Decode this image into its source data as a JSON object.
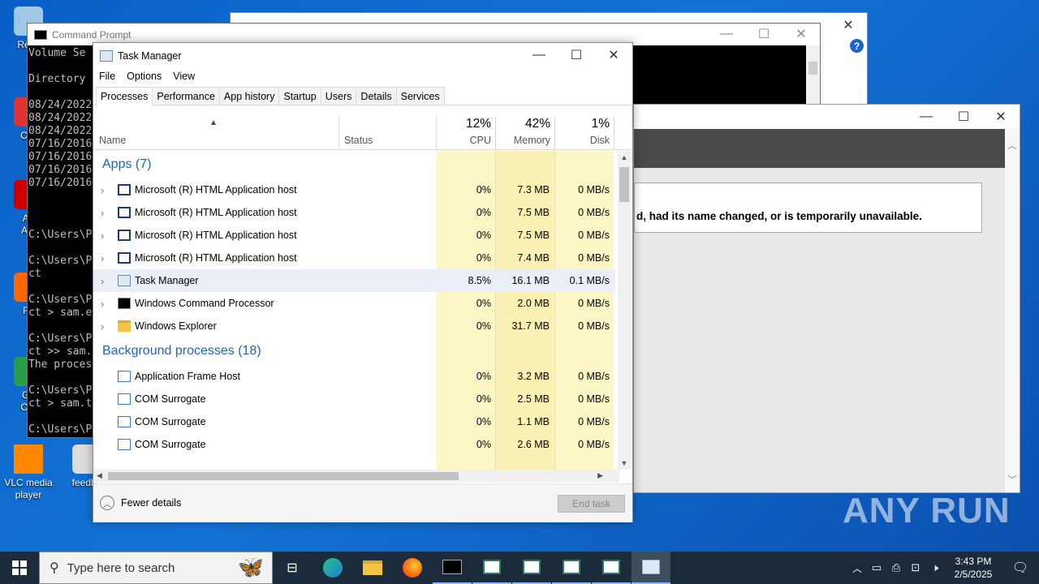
{
  "desktop": {
    "icons": [
      {
        "label": "Recy",
        "icon": "recycle-bin-icon"
      },
      {
        "label": "CCl",
        "icon": "ccleaner-icon"
      },
      {
        "label": "Ad\nAcr",
        "icon": "acrobat-icon"
      },
      {
        "label": "Fir",
        "icon": "firefox-icon"
      },
      {
        "label": "Go\nChr",
        "icon": "chrome-icon"
      },
      {
        "label": "VLC media\nplayer",
        "icon": "vlc-icon"
      },
      {
        "label": "feedba",
        "icon": "file-icon"
      }
    ]
  },
  "cmd": {
    "title": "Command Prompt",
    "lines": "Volume Se\n\nDirectory\n\n08/24/2022\n08/24/2022\n08/24/2022\n07/16/2016\n07/16/2016\n07/16/2016\n07/16/2016\n\n\n\nC:\\Users\\P\n\nC:\\Users\\P\nct\n\nC:\\Users\\P\nct > sam.e\n\nC:\\Users\\P\nct >> sam.\nThe proces\n\nC:\\Users\\P\nct > sam.t\n\nC:\\Users\\P"
  },
  "browser": {
    "error_text": "d, had its name changed, or is temporarily unavailable."
  },
  "taskmanager": {
    "title": "Task Manager",
    "menu": [
      "File",
      "Options",
      "View"
    ],
    "tabs": [
      "Processes",
      "Performance",
      "App history",
      "Startup",
      "Users",
      "Details",
      "Services"
    ],
    "active_tab": "Processes",
    "columns": {
      "name": "Name",
      "status": "Status",
      "cpu_pct": "12%",
      "cpu": "CPU",
      "mem_pct": "42%",
      "mem": "Memory",
      "disk_pct": "1%",
      "disk": "Disk"
    },
    "groups": [
      {
        "label": "Apps (7)",
        "rows": [
          {
            "name": "Microsoft (R) HTML Application host",
            "cpu": "0%",
            "mem": "7.3 MB",
            "disk": "0 MB/s",
            "icon": "window-icon",
            "expandable": true
          },
          {
            "name": "Microsoft (R) HTML Application host",
            "cpu": "0%",
            "mem": "7.5 MB",
            "disk": "0 MB/s",
            "icon": "window-icon",
            "expandable": true
          },
          {
            "name": "Microsoft (R) HTML Application host",
            "cpu": "0%",
            "mem": "7.5 MB",
            "disk": "0 MB/s",
            "icon": "window-icon",
            "expandable": true
          },
          {
            "name": "Microsoft (R) HTML Application host",
            "cpu": "0%",
            "mem": "7.4 MB",
            "disk": "0 MB/s",
            "icon": "window-icon",
            "expandable": true
          },
          {
            "name": "Task Manager",
            "cpu": "8.5%",
            "mem": "16.1 MB",
            "disk": "0.1 MB/s",
            "icon": "task-manager-icon",
            "expandable": true,
            "selected": true
          },
          {
            "name": "Windows Command Processor",
            "cpu": "0%",
            "mem": "2.0 MB",
            "disk": "0 MB/s",
            "icon": "cmd-icon",
            "expandable": true
          },
          {
            "name": "Windows Explorer",
            "cpu": "0%",
            "mem": "31.7 MB",
            "disk": "0 MB/s",
            "icon": "folder-icon",
            "expandable": true
          }
        ]
      },
      {
        "label": "Background processes (18)",
        "rows": [
          {
            "name": "Application Frame Host",
            "cpu": "0%",
            "mem": "3.2 MB",
            "disk": "0 MB/s",
            "icon": "app-icon",
            "expandable": false
          },
          {
            "name": "COM Surrogate",
            "cpu": "0%",
            "mem": "2.5 MB",
            "disk": "0 MB/s",
            "icon": "app-icon",
            "expandable": false
          },
          {
            "name": "COM Surrogate",
            "cpu": "0%",
            "mem": "1.1 MB",
            "disk": "0 MB/s",
            "icon": "app-icon",
            "expandable": false
          },
          {
            "name": "COM Surrogate",
            "cpu": "0%",
            "mem": "2.6 MB",
            "disk": "0 MB/s",
            "icon": "app-icon",
            "expandable": false
          }
        ]
      }
    ],
    "fewer_details": "Fewer details",
    "end_task": "End task"
  },
  "taskbar": {
    "search_placeholder": "Type here to search",
    "time": "3:43 PM",
    "date": "2/5/2025"
  },
  "watermark": "ANY RUN",
  "colors": {
    "cpu_band": "#fdf7c8",
    "mem_band": "#fbf1b4",
    "group_text": "#2264b4",
    "taskbar": "#1c2b3c"
  }
}
